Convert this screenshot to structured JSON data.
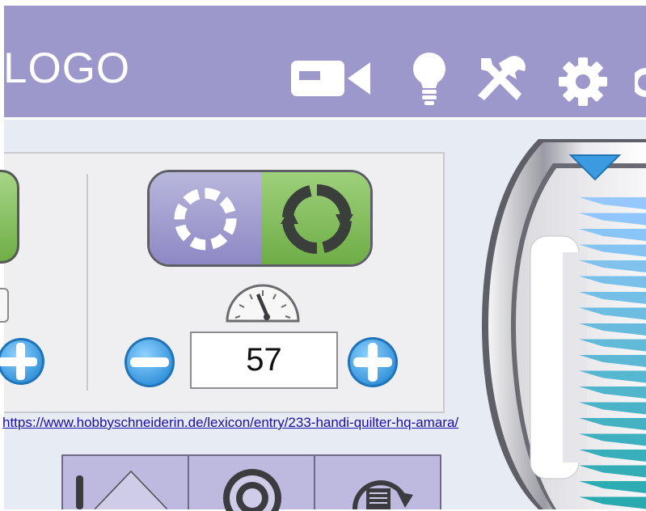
{
  "header": {
    "logo_text": "LOGO",
    "icons": [
      "video-camera-icon",
      "lightbulb-icon",
      "tools-icon",
      "gear-icon"
    ]
  },
  "controls": {
    "mode_toggle": {
      "left_icon": "dotted-circle-icon",
      "right_icon": "refresh-arrows-icon",
      "active": "right"
    },
    "speed_gauge_icon": "speedometer-icon",
    "speed_value": "57",
    "decrease_icon": "minus-circle-icon",
    "increase_icon": "plus-circle-icon"
  },
  "link": {
    "text": "https://www.hobbyschneiderin.de/lexicon/entry/233-handi-quilter-hq-amara/"
  },
  "bottom_bar": {
    "buttons": [
      "needle-position-icon",
      "bobbin-icon",
      "bobbin-wind-icon"
    ]
  },
  "colors": {
    "header": "#9d98cb",
    "background": "#e7ebf4",
    "accent_green": "#6ead46",
    "accent_blue": "#4aa3e0",
    "toggle_purple": "#8d88c4"
  }
}
